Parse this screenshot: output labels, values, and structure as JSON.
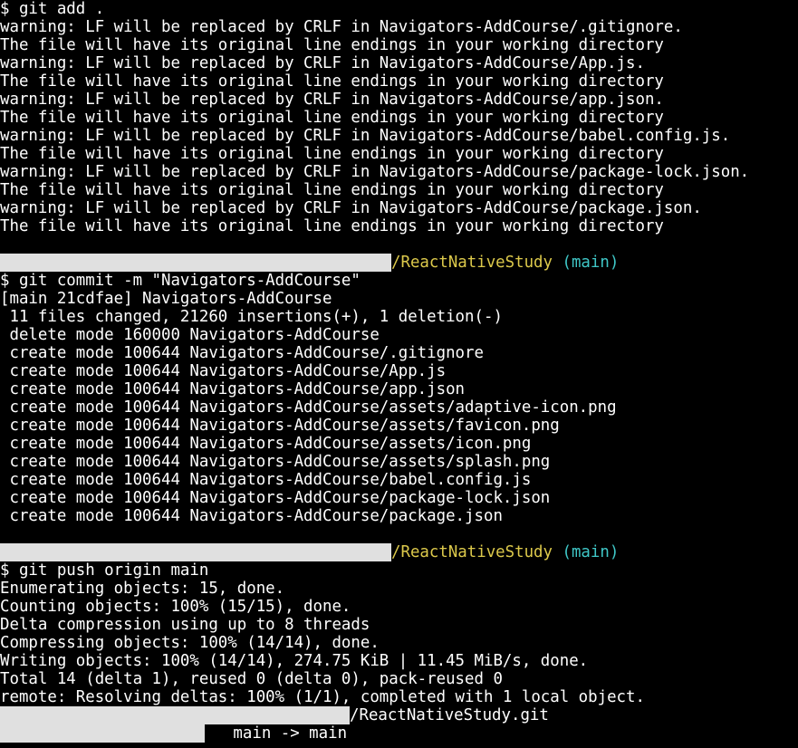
{
  "colors": {
    "background": "#000000",
    "text": "#ffffff",
    "path": "#dcc94b",
    "branch": "#3fc7c7",
    "redaction": "#e0e0e0"
  },
  "block_add": {
    "command": "$ git add .",
    "output": [
      "warning: LF will be replaced by CRLF in Navigators-AddCourse/.gitignore.",
      "The file will have its original line endings in your working directory",
      "warning: LF will be replaced by CRLF in Navigators-AddCourse/App.js.",
      "The file will have its original line endings in your working directory",
      "warning: LF will be replaced by CRLF in Navigators-AddCourse/app.json.",
      "The file will have its original line endings in your working directory",
      "warning: LF will be replaced by CRLF in Navigators-AddCourse/babel.config.js.",
      "The file will have its original line endings in your working directory",
      "warning: LF will be replaced by CRLF in Navigators-AddCourse/package-lock.json.",
      "The file will have its original line endings in your working directory",
      "warning: LF will be replaced by CRLF in Navigators-AddCourse/package.json.",
      "The file will have its original line endings in your working directory"
    ]
  },
  "prompt_1": {
    "path": "/ReactNativeStudy",
    "branch": "(main)"
  },
  "block_commit": {
    "command": "$ git commit -m \"Navigators-AddCourse\"",
    "output": [
      "[main 21cdfae] Navigators-AddCourse",
      " 11 files changed, 21260 insertions(+), 1 deletion(-)",
      " delete mode 160000 Navigators-AddCourse",
      " create mode 100644 Navigators-AddCourse/.gitignore",
      " create mode 100644 Navigators-AddCourse/App.js",
      " create mode 100644 Navigators-AddCourse/app.json",
      " create mode 100644 Navigators-AddCourse/assets/adaptive-icon.png",
      " create mode 100644 Navigators-AddCourse/assets/favicon.png",
      " create mode 100644 Navigators-AddCourse/assets/icon.png",
      " create mode 100644 Navigators-AddCourse/assets/splash.png",
      " create mode 100644 Navigators-AddCourse/babel.config.js",
      " create mode 100644 Navigators-AddCourse/package-lock.json",
      " create mode 100644 Navigators-AddCourse/package.json"
    ]
  },
  "prompt_2": {
    "path": "/ReactNativeStudy",
    "branch": "(main)"
  },
  "block_push": {
    "command": "$ git push origin main",
    "output": [
      "Enumerating objects: 15, done.",
      "Counting objects: 100% (15/15), done.",
      "Delta compression using up to 8 threads",
      "Compressing objects: 100% (14/14), done.",
      "Writing objects: 100% (14/14), 274.75 KiB | 11.45 MiB/s, done.",
      "Total 14 (delta 1), reused 0 (delta 0), pack-reused 0",
      "remote: Resolving deltas: 100% (1/1), completed with 1 local object."
    ],
    "remote_url_suffix": "/ReactNativeStudy.git",
    "ref_update": "   main -> main"
  }
}
